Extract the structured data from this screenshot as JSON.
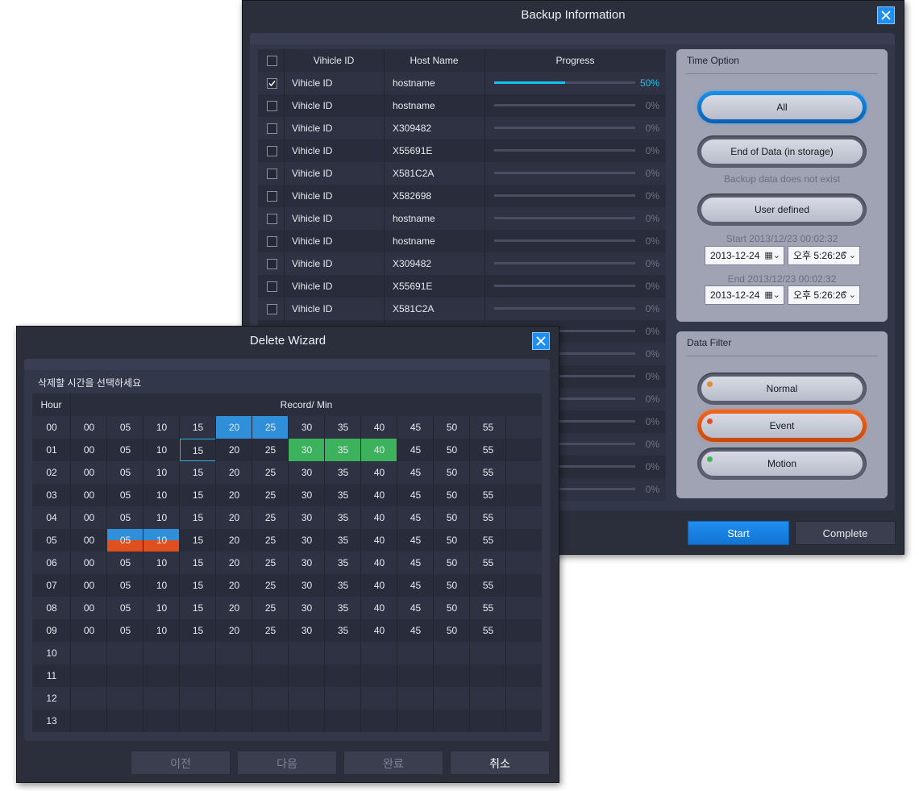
{
  "backup": {
    "title": "Backup Information",
    "columns": [
      "Vihicle ID",
      "Host Name",
      "Progress"
    ],
    "rows": [
      {
        "vehicle": "Vihicle ID",
        "host": "hostname",
        "progress": 50,
        "progress_label": "50%",
        "checked": true
      },
      {
        "vehicle": "Vihicle ID",
        "host": "hostname",
        "progress": 0,
        "progress_label": "0%",
        "checked": false
      },
      {
        "vehicle": "Vihicle ID",
        "host": "X309482",
        "progress": 0,
        "progress_label": "0%",
        "checked": false
      },
      {
        "vehicle": "Vihicle ID",
        "host": "X55691E",
        "progress": 0,
        "progress_label": "0%",
        "checked": false
      },
      {
        "vehicle": "Vihicle ID",
        "host": "X581C2A",
        "progress": 0,
        "progress_label": "0%",
        "checked": false
      },
      {
        "vehicle": "Vihicle ID",
        "host": "X582698",
        "progress": 0,
        "progress_label": "0%",
        "checked": false
      },
      {
        "vehicle": "Vihicle ID",
        "host": "hostname",
        "progress": 0,
        "progress_label": "0%",
        "checked": false
      },
      {
        "vehicle": "Vihicle ID",
        "host": "hostname",
        "progress": 0,
        "progress_label": "0%",
        "checked": false
      },
      {
        "vehicle": "Vihicle ID",
        "host": "X309482",
        "progress": 0,
        "progress_label": "0%",
        "checked": false
      },
      {
        "vehicle": "Vihicle ID",
        "host": "X55691E",
        "progress": 0,
        "progress_label": "0%",
        "checked": false
      },
      {
        "vehicle": "Vihicle ID",
        "host": "X581C2A",
        "progress": 0,
        "progress_label": "0%",
        "checked": false
      },
      {
        "vehicle": "",
        "host": "",
        "progress": 0,
        "progress_label": "0%",
        "checked": false
      },
      {
        "vehicle": "",
        "host": "",
        "progress": 0,
        "progress_label": "0%",
        "checked": false
      },
      {
        "vehicle": "",
        "host": "",
        "progress": 0,
        "progress_label": "0%",
        "checked": false
      },
      {
        "vehicle": "",
        "host": "",
        "progress": 0,
        "progress_label": "0%",
        "checked": false
      },
      {
        "vehicle": "",
        "host": "",
        "progress": 0,
        "progress_label": "0%",
        "checked": false
      },
      {
        "vehicle": "",
        "host": "",
        "progress": 0,
        "progress_label": "0%",
        "checked": false
      },
      {
        "vehicle": "",
        "host": "",
        "progress": 0,
        "progress_label": "0%",
        "checked": false
      },
      {
        "vehicle": "",
        "host": "",
        "progress": 0,
        "progress_label": "0%",
        "checked": false
      }
    ],
    "time_option": {
      "title": "Time Option",
      "all_label": "All",
      "end_of_data_label": "End of Data (in storage)",
      "end_of_data_note": "Backup data does not exist",
      "user_defined_label": "User defined",
      "start_label": "Start  2013/12/23 00:02:32",
      "start_date": "2013-12-24",
      "start_time": "오후 5:26:26",
      "end_label": "End  2013/12/23 00:02:32",
      "end_date": "2013-12-24",
      "end_time": "오후 5:26:26"
    },
    "data_filter": {
      "title": "Data Filter",
      "normal_label": "Normal",
      "event_label": "Event",
      "motion_label": "Motion"
    },
    "start_button": "Start",
    "complete_button": "Complete"
  },
  "wizard": {
    "title": "Delete Wizard",
    "instruction": "삭제할 시간을 선택하세요",
    "hour_header": "Hour",
    "record_header": "Record/ Min",
    "minutes": [
      "00",
      "05",
      "10",
      "15",
      "20",
      "25",
      "30",
      "35",
      "40",
      "45",
      "50",
      "55"
    ],
    "hours": [
      "00",
      "01",
      "02",
      "03",
      "04",
      "05",
      "06",
      "07",
      "08",
      "09",
      "10",
      "11",
      "12",
      "13"
    ],
    "hours_with_records": 10,
    "highlights": [
      {
        "hour": "00",
        "minutes": [
          "20",
          "25"
        ],
        "color": "blue"
      },
      {
        "hour": "01",
        "minutes": [
          "30",
          "35",
          "40"
        ],
        "color": "green"
      },
      {
        "hour": "01",
        "minutes": [
          "15"
        ],
        "color": "outline"
      },
      {
        "hour": "05",
        "minutes": [
          "05",
          "10"
        ],
        "color": "blue-orange"
      }
    ],
    "prev_button": "이전",
    "next_button": "다음",
    "finish_button": "완료",
    "cancel_button": "취소"
  }
}
